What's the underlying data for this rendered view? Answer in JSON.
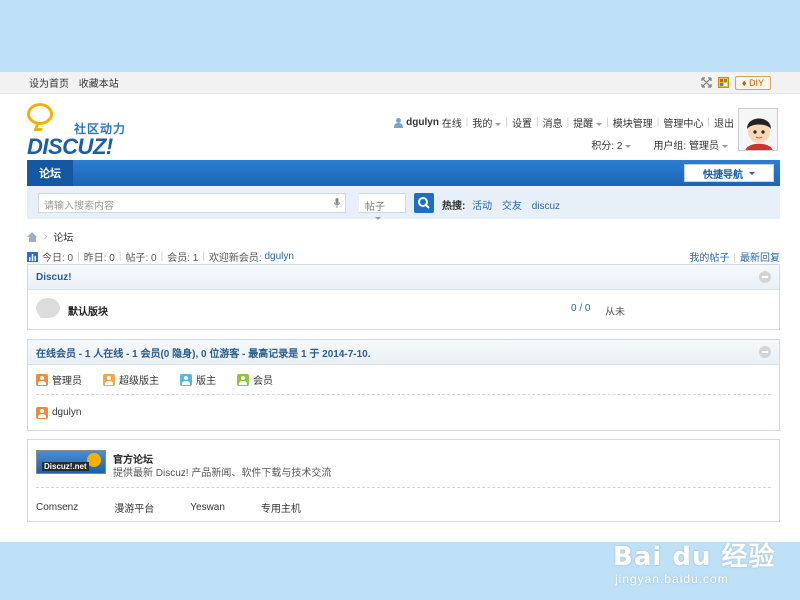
{
  "topbar": {
    "set_home": "设为首页",
    "bookmark": "收藏本站",
    "diy": "DIY"
  },
  "logo": {
    "cn": "社区动力",
    "en": "DISCUZ!"
  },
  "user": {
    "name": "dgulyn",
    "status": "在线",
    "mine": "我的",
    "settings": "设置",
    "messages": "消息",
    "reminders": "提醒",
    "module_manage": "模块管理",
    "admin_center": "管理中心",
    "logout": "退出",
    "credits": "积分: 2",
    "group": "用户组: 管理员"
  },
  "nav": {
    "forum_tab": "论坛",
    "quick_nav": "快捷导航"
  },
  "search": {
    "placeholder": "请输入搜索内容",
    "type": "帖子",
    "hot_label": "热搜:",
    "hot": [
      "活动",
      "交友",
      "discuz"
    ]
  },
  "breadcrumb": {
    "current": "论坛"
  },
  "stats": {
    "today": "今日: 0",
    "yesterday": "昨日: 0",
    "posts": "帖子: 0",
    "members": "会员: 1",
    "welcome": "欢迎新会员:",
    "new_member": "dgulyn",
    "my_posts": "我的帖子",
    "latest_reply": "最新回复"
  },
  "category": {
    "title": "Discuz!",
    "forums": [
      {
        "name": "默认版块",
        "count": "0 / 0",
        "last": "从未"
      }
    ]
  },
  "online": {
    "title": "在线会员 - 1 人在线 - 1 会员(0 隐身), 0 位游客 - 最高记录是 1 于 2014-7-10.",
    "legend": [
      {
        "label": "管理员",
        "color": "#f08a3c"
      },
      {
        "label": "超级版主",
        "color": "#f3a64a"
      },
      {
        "label": "版主",
        "color": "#5bb4e6"
      },
      {
        "label": "会员",
        "color": "#8cc63f"
      }
    ],
    "users": [
      "dgulyn"
    ]
  },
  "links": {
    "logo_text": "Discuz!.net",
    "title": "官方论坛",
    "desc": "提供最新 Discuz! 产品新闻、软件下载与技术交流",
    "items": [
      "Comsenz",
      "漫游平台",
      "Yeswan",
      "专用主机"
    ]
  },
  "watermark": {
    "main": "Bai du 经验",
    "sub": "jingyan.baidu.com"
  }
}
